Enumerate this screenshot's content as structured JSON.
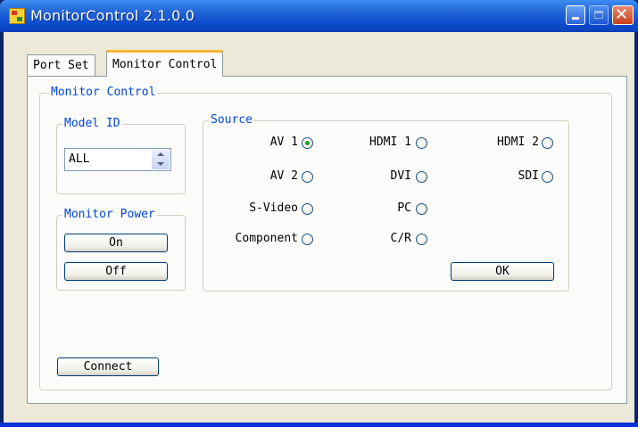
{
  "window": {
    "title": "MonitorControl  2.1.0.0"
  },
  "tabs": [
    {
      "label": "Port Set",
      "active": false
    },
    {
      "label": "Monitor Control",
      "active": true
    }
  ],
  "monitor_control": {
    "group_label": "Monitor Control",
    "model_id": {
      "label": "Model ID",
      "value": "ALL"
    },
    "monitor_power": {
      "label": "Monitor Power",
      "on_label": "On",
      "off_label": "Off"
    },
    "source": {
      "label": "Source",
      "options": [
        {
          "label": "AV 1",
          "checked": true
        },
        {
          "label": "AV 2",
          "checked": false
        },
        {
          "label": "S-Video",
          "checked": false
        },
        {
          "label": "Component",
          "checked": false
        },
        {
          "label": "HDMI 1",
          "checked": false
        },
        {
          "label": "DVI",
          "checked": false
        },
        {
          "label": "PC",
          "checked": false
        },
        {
          "label": "C/R",
          "checked": false
        },
        {
          "label": "HDMI 2",
          "checked": false
        },
        {
          "label": "SDI",
          "checked": false
        }
      ],
      "ok_label": "OK"
    },
    "connect_label": "Connect"
  },
  "colors": {
    "titlebar": "#245edb",
    "dialog_bg": "#ece9d8",
    "group_label": "#0046d5",
    "radio_checked": "#21a121",
    "tab_highlight": "#f9b437"
  }
}
